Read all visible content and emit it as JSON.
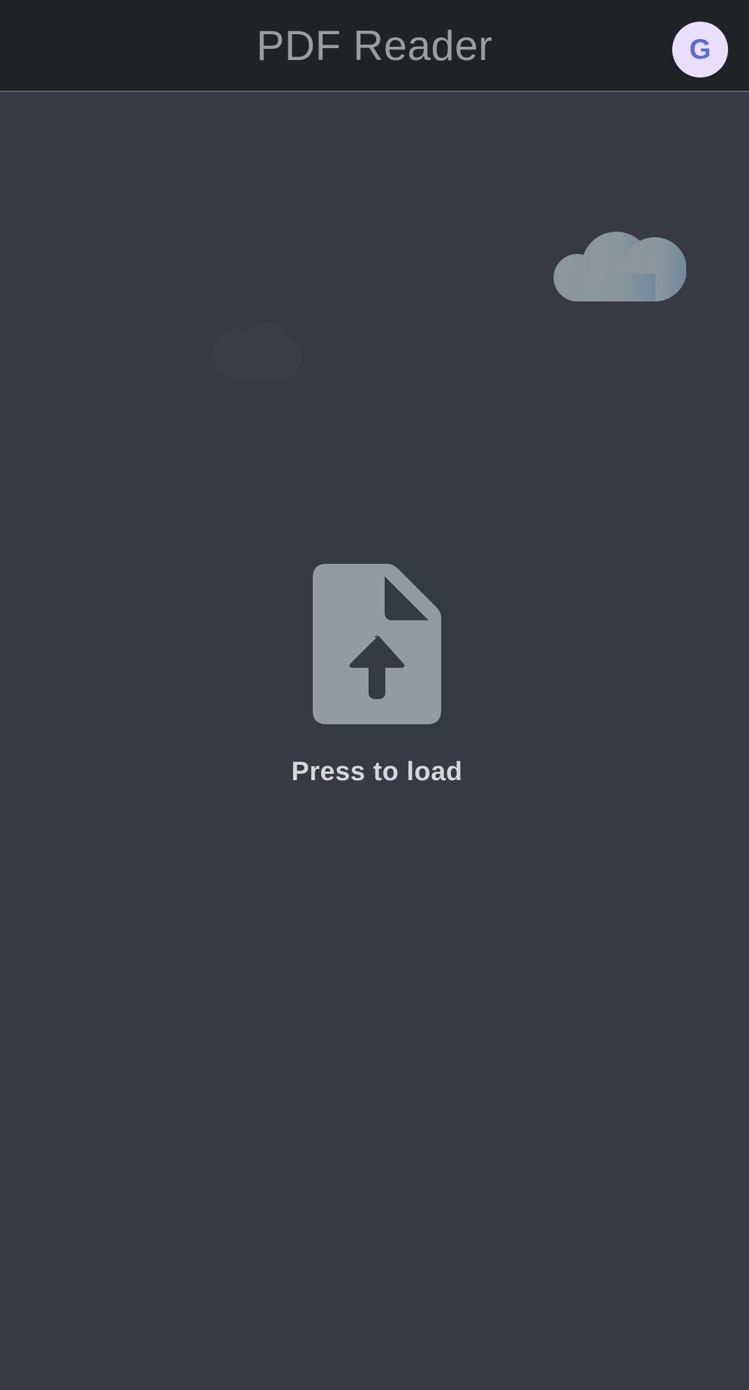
{
  "app_bar": {
    "title": "PDF Reader",
    "avatar_initial": "G"
  },
  "main": {
    "load_label": "Press to load",
    "icon": "file-upload-icon"
  },
  "colors": {
    "app_bar_bg": "#202326",
    "content_bg": "#373a44",
    "avatar_bg": "#e9dffb",
    "avatar_text": "#5b6ad8",
    "icon_fill": "#9599a3",
    "label_text": "#d6d7da"
  }
}
